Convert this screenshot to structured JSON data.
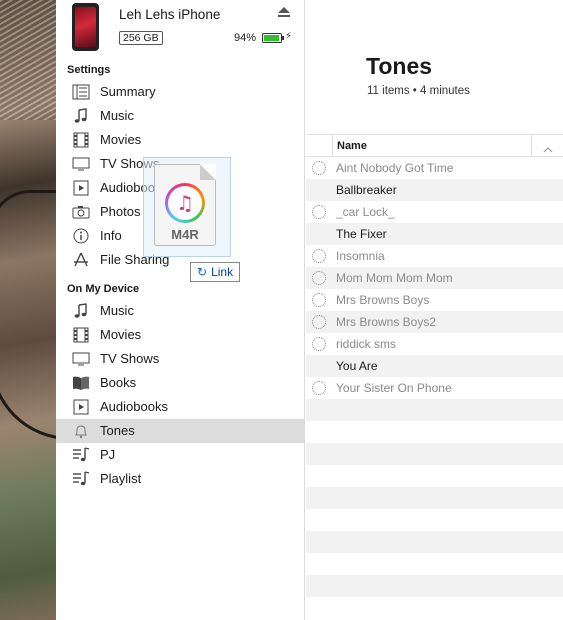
{
  "device": {
    "name": "Leh Lehs iPhone",
    "capacity": "256 GB",
    "battery_pct": "94%",
    "battery_level": 0.94,
    "charging_glyph": "⚡"
  },
  "settings": {
    "title": "Settings",
    "items": [
      {
        "label": "Summary",
        "icon": "summary-icon"
      },
      {
        "label": "Music",
        "icon": "music-note-icon"
      },
      {
        "label": "Movies",
        "icon": "film-icon"
      },
      {
        "label": "TV Shows",
        "icon": "tv-icon"
      },
      {
        "label": "Audiobooks",
        "icon": "audiobook-icon"
      },
      {
        "label": "Photos",
        "icon": "camera-icon"
      },
      {
        "label": "Info",
        "icon": "info-icon"
      },
      {
        "label": "File Sharing",
        "icon": "app-store-icon"
      }
    ]
  },
  "on_device": {
    "title": "On My Device",
    "items": [
      {
        "label": "Music",
        "icon": "music-note-icon"
      },
      {
        "label": "Movies",
        "icon": "film-icon"
      },
      {
        "label": "TV Shows",
        "icon": "tv-icon"
      },
      {
        "label": "Books",
        "icon": "book-icon"
      },
      {
        "label": "Audiobooks",
        "icon": "audiobook-icon"
      },
      {
        "label": "Tones",
        "icon": "bell-icon",
        "selected": true
      },
      {
        "label": "PJ",
        "icon": "playlist-icon"
      },
      {
        "label": "Playlist",
        "icon": "playlist-icon"
      }
    ]
  },
  "main": {
    "title": "Tones",
    "subtitle": "11 items • 4 minutes",
    "column_name": "Name",
    "rows": [
      {
        "name": "Aint Nobody Got Time",
        "pending": true
      },
      {
        "name": "Ballbreaker",
        "pending": false
      },
      {
        "name": "_car Lock_",
        "pending": true
      },
      {
        "name": "The Fixer",
        "pending": false
      },
      {
        "name": "Insomnia",
        "pending": true
      },
      {
        "name": "Mom Mom Mom Mom",
        "pending": true
      },
      {
        "name": "Mrs Browns Boys",
        "pending": true
      },
      {
        "name": "Mrs Browns Boys2",
        "pending": true
      },
      {
        "name": "riddick sms",
        "pending": true
      },
      {
        "name": "You Are",
        "pending": false
      },
      {
        "name": "Your Sister On Phone",
        "pending": true
      }
    ]
  },
  "drag": {
    "file_ext": "M4R",
    "tooltip": "Link",
    "link_glyph": "↻"
  },
  "colors": {
    "selected_bg": "#dcdcdc",
    "battery_fill": "#2fbf2f",
    "stripe": "#f2f2f2"
  }
}
